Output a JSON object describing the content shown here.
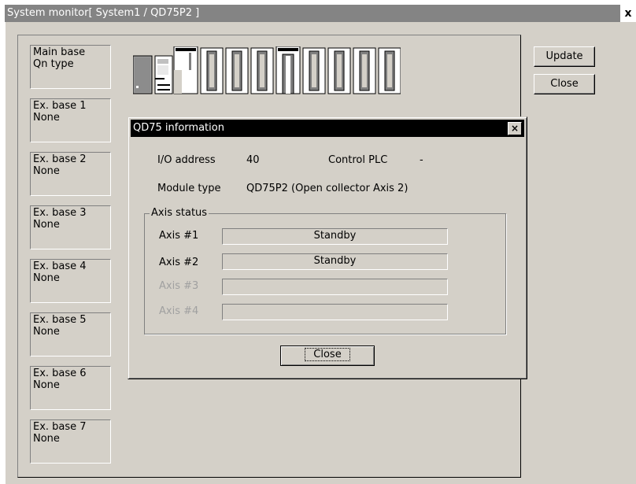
{
  "window": {
    "title": "System monitor[ System1 / QD75P2 ]",
    "close_glyph": "x"
  },
  "bases": [
    {
      "name": "Main base",
      "type": "Qn type"
    },
    {
      "name": "Ex. base 1",
      "type": "None"
    },
    {
      "name": "Ex. base 2",
      "type": "None"
    },
    {
      "name": "Ex. base 3",
      "type": "None"
    },
    {
      "name": "Ex. base 4",
      "type": "None"
    },
    {
      "name": "Ex. base 5",
      "type": "None"
    },
    {
      "name": "Ex. base 6",
      "type": "None"
    },
    {
      "name": "Ex. base 7",
      "type": "None"
    }
  ],
  "buttons": {
    "update": "Update",
    "close": "Close"
  },
  "dialog": {
    "title": "QD75 information",
    "close_glyph": "×",
    "io_address_label": "I/O address",
    "io_address_value": "40",
    "control_plc_label": "Control PLC",
    "control_plc_value": "-",
    "module_type_label": "Module type",
    "module_type_value": "QD75P2 (Open collector Axis 2)",
    "axis_group_title": "Axis status",
    "axes": [
      {
        "label": "Axis #1",
        "status": "Standby"
      },
      {
        "label": "Axis #2",
        "status": "Standby"
      },
      {
        "label": "Axis #3",
        "status": ""
      },
      {
        "label": "Axis #4",
        "status": ""
      }
    ],
    "close_button": "Close"
  }
}
